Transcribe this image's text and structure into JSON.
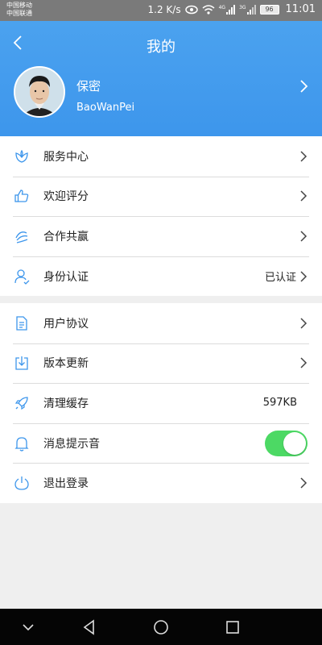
{
  "status_bar": {
    "carrier1": "中国移动",
    "carrier2": "中国联通",
    "speed": "1.2 K/s",
    "battery": "96",
    "time": "11:01",
    "network_labels": [
      "4G",
      "3G"
    ]
  },
  "header": {
    "title": "我的",
    "user_name": "保密",
    "user_id": "BaoWanPei",
    "color": "#3d96ec"
  },
  "group1": [
    {
      "label": "服务中心",
      "icon": "flower-icon"
    },
    {
      "label": "欢迎评分",
      "icon": "thumbs-up-icon"
    },
    {
      "label": "合作共赢",
      "icon": "handshake-icon"
    },
    {
      "label": "身份认证",
      "icon": "person-icon",
      "value": "已认证"
    }
  ],
  "group2": [
    {
      "label": "用户协议",
      "icon": "document-icon"
    },
    {
      "label": "版本更新",
      "icon": "download-icon"
    },
    {
      "label": "清理缓存",
      "icon": "rocket-icon",
      "value": "597KB"
    },
    {
      "label": "消息提示音",
      "icon": "bell-icon",
      "toggle": true
    },
    {
      "label": "退出登录",
      "icon": "power-icon"
    }
  ],
  "accent": "#4cd964",
  "nav_bar": [
    "chevron-down-icon",
    "back-triangle-icon",
    "home-circle-icon",
    "recents-square-icon"
  ]
}
